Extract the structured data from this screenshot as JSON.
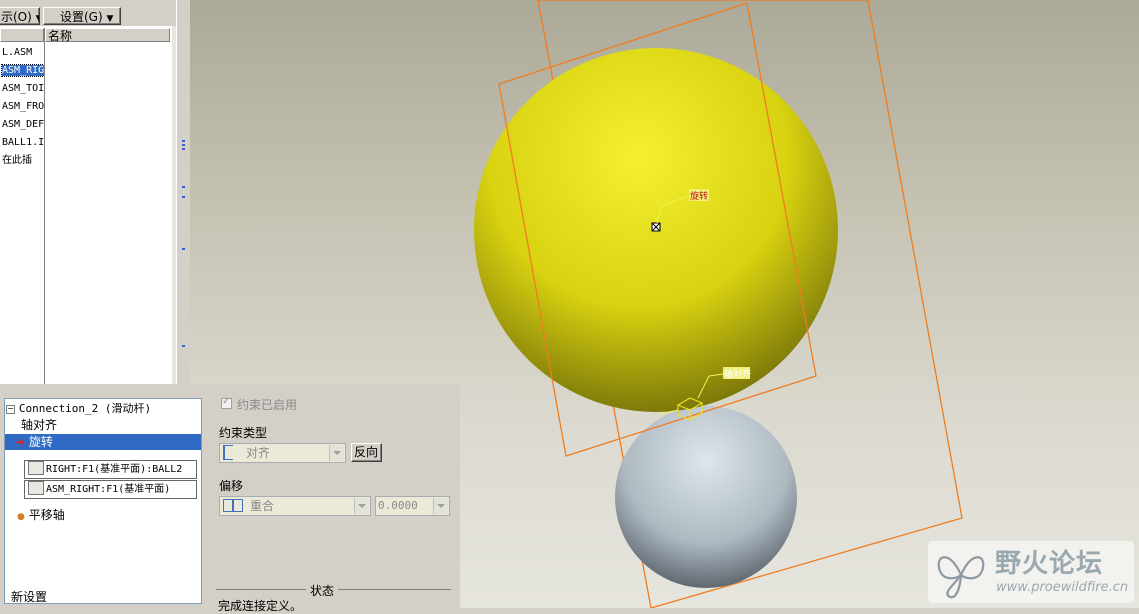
{
  "toolbar": {
    "show_label": "示(O)",
    "settings_label": "设置(G)"
  },
  "model_tree": {
    "name_header": "名称",
    "items": [
      {
        "label": "L.ASM",
        "selected": false
      },
      {
        "label": "ASM_RIG",
        "selected": true
      },
      {
        "label": "ASM_TOI",
        "selected": false
      },
      {
        "label": "ASM_FRO",
        "selected": false
      },
      {
        "label": "ASM_DEF",
        "selected": false
      },
      {
        "label": "BALL1.I",
        "selected": false
      },
      {
        "label": "在此插",
        "selected": false
      }
    ]
  },
  "viewport": {
    "rotate_tag": "旋转",
    "axis_align_tag": "轴对齐",
    "colors": {
      "top_ball": "#e4e010",
      "bottom_ball": "#b8c4cc",
      "datum_plane": "#f07c20",
      "tag_bg": "#f0f078"
    }
  },
  "connections": {
    "connection_name": "Connection_2 (滑动杆)",
    "axis_align": "轴对齐",
    "rotate": "旋转",
    "ref1": "RIGHT:F1(基准平面):BALL2",
    "ref2": "ASM_RIGHT:F1(基准平面)",
    "translation_axis": "平移轴",
    "new_set": "新设置"
  },
  "constraint": {
    "enabled_label": "约束已启用",
    "type_label": "约束类型",
    "type_value": "对齐",
    "flip_button": "反向",
    "offset_label": "偏移",
    "offset_value": "重合",
    "offset_number": "0.0000",
    "status_label": "状态",
    "status_text": "完成连接定义。"
  },
  "watermark": {
    "title": "野火论坛",
    "url": "www.proewildfire.cn"
  }
}
